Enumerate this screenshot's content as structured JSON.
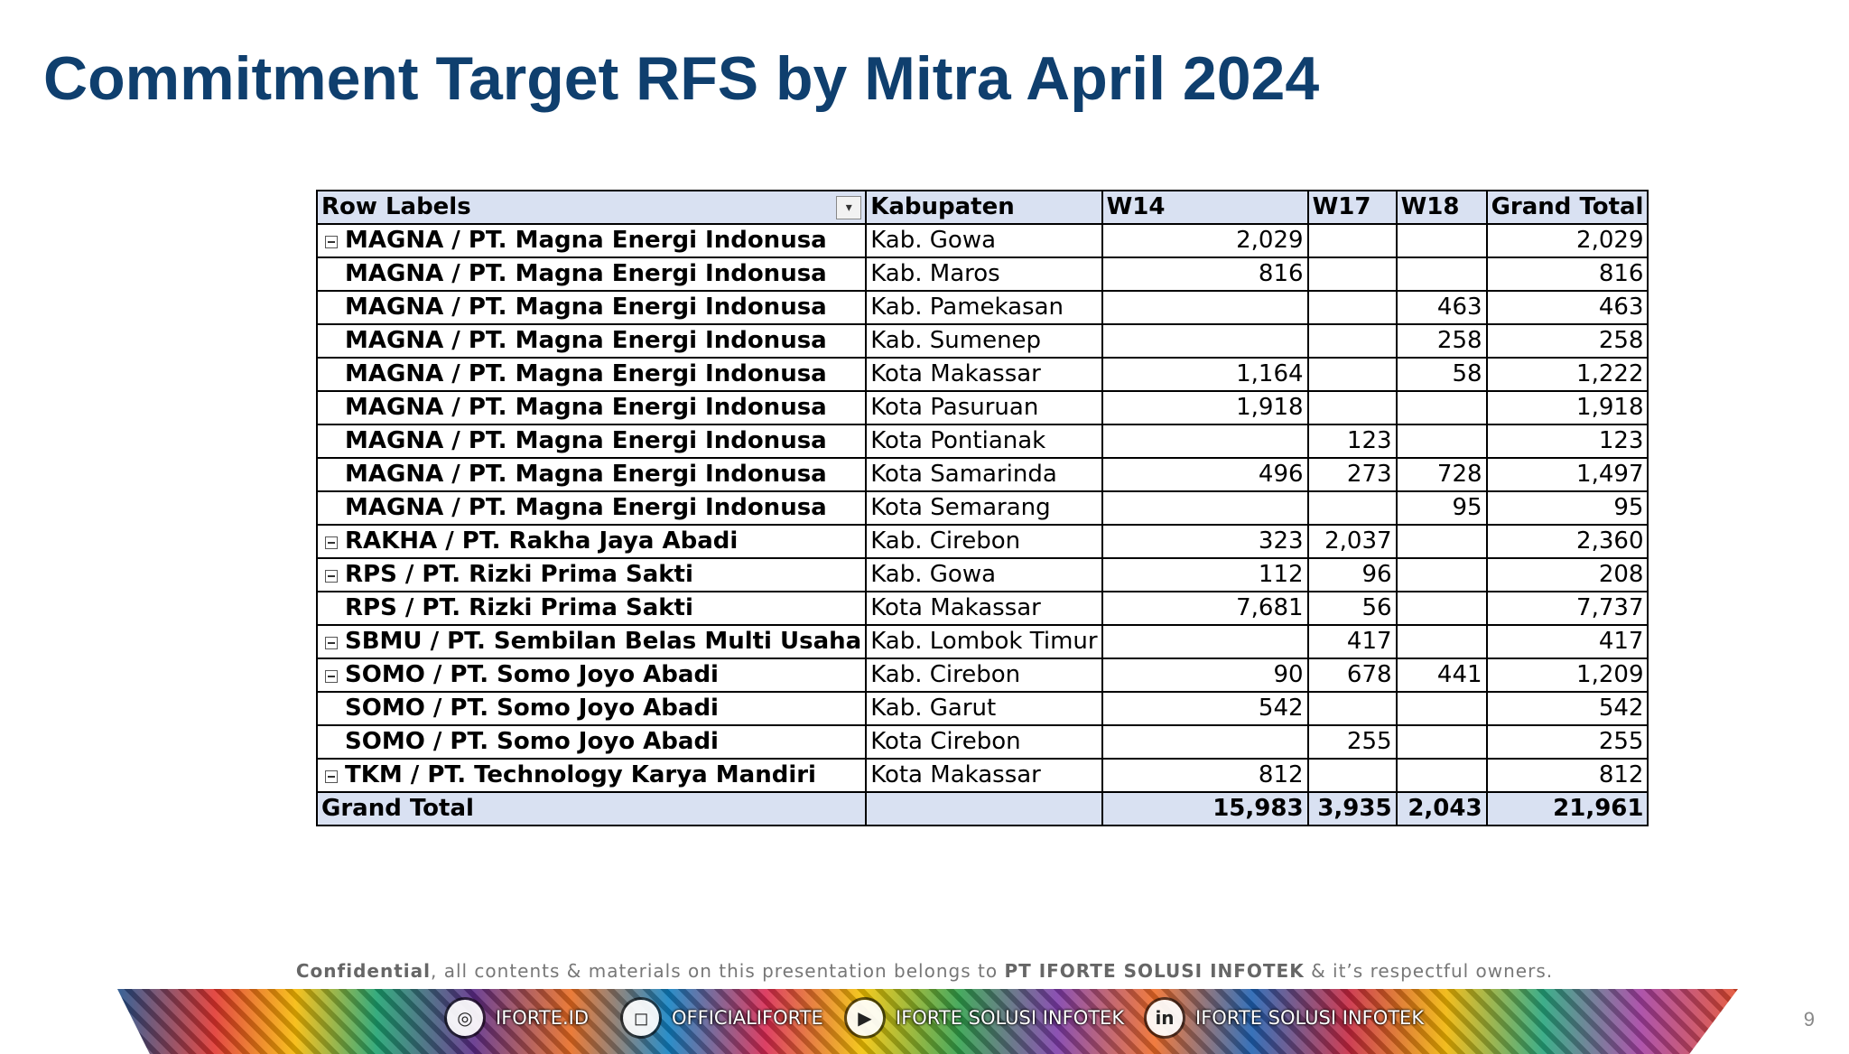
{
  "title": "Commitment Target RFS by Mitra April 2024",
  "table": {
    "headers": [
      "Row Labels",
      "Kabupaten",
      "W14",
      "W17",
      "W18",
      "Grand Total"
    ],
    "rows": [
      {
        "label": "MAGNA / PT. Magna Energi Indonusa",
        "kab": "Kab. Gowa",
        "w14": "2,029",
        "w17": "",
        "w18": "",
        "total": "2,029"
      },
      {
        "label": "MAGNA / PT. Magna Energi Indonusa",
        "kab": "Kab. Maros",
        "w14": "816",
        "w17": "",
        "w18": "",
        "total": "816"
      },
      {
        "label": "MAGNA / PT. Magna Energi Indonusa",
        "kab": "Kab. Pamekasan",
        "w14": "",
        "w17": "",
        "w18": "463",
        "total": "463"
      },
      {
        "label": "MAGNA / PT. Magna Energi Indonusa",
        "kab": "Kab. Sumenep",
        "w14": "",
        "w17": "",
        "w18": "258",
        "total": "258"
      },
      {
        "label": "MAGNA / PT. Magna Energi Indonusa",
        "kab": "Kota Makassar",
        "w14": "1,164",
        "w17": "",
        "w18": "58",
        "total": "1,222"
      },
      {
        "label": "MAGNA / PT. Magna Energi Indonusa",
        "kab": "Kota Pasuruan",
        "w14": "1,918",
        "w17": "",
        "w18": "",
        "total": "1,918"
      },
      {
        "label": "MAGNA / PT. Magna Energi Indonusa",
        "kab": "Kota Pontianak",
        "w14": "",
        "w17": "123",
        "w18": "",
        "total": "123"
      },
      {
        "label": "MAGNA / PT. Magna Energi Indonusa",
        "kab": "Kota Samarinda",
        "w14": "496",
        "w17": "273",
        "w18": "728",
        "total": "1,497"
      },
      {
        "label": "MAGNA / PT. Magna Energi Indonusa",
        "kab": "Kota Semarang",
        "w14": "",
        "w17": "",
        "w18": "95",
        "total": "95"
      },
      {
        "label": "RAKHA / PT. Rakha Jaya Abadi",
        "kab": "Kab. Cirebon",
        "w14": "323",
        "w17": "2,037",
        "w18": "",
        "total": "2,360"
      },
      {
        "label": "RPS / PT. Rizki Prima Sakti",
        "kab": "Kab. Gowa",
        "w14": "112",
        "w17": "96",
        "w18": "",
        "total": "208"
      },
      {
        "label": "RPS / PT. Rizki Prima Sakti",
        "kab": "Kota Makassar",
        "w14": "7,681",
        "w17": "56",
        "w18": "",
        "total": "7,737"
      },
      {
        "label": "SBMU / PT. Sembilan Belas Multi Usaha",
        "kab": "Kab. Lombok Timur",
        "w14": "",
        "w17": "417",
        "w18": "",
        "total": "417"
      },
      {
        "label": "SOMO / PT. Somo Joyo Abadi",
        "kab": "Kab. Cirebon",
        "w14": "90",
        "w17": "678",
        "w18": "441",
        "total": "1,209"
      },
      {
        "label": "SOMO / PT. Somo Joyo Abadi",
        "kab": "Kab. Garut",
        "w14": "542",
        "w17": "",
        "w18": "",
        "total": "542"
      },
      {
        "label": "SOMO / PT. Somo Joyo Abadi",
        "kab": "Kota Cirebon",
        "w14": "",
        "w17": "255",
        "w18": "",
        "total": "255"
      },
      {
        "label": "TKM / PT. Technology Karya Mandiri",
        "kab": "Kota Makassar",
        "w14": "812",
        "w17": "",
        "w18": "",
        "total": "812"
      }
    ],
    "group_start_rows": [
      0,
      9,
      10,
      12,
      13,
      16
    ],
    "grand_total": {
      "label": "Grand Total",
      "kab": "",
      "w14": "15,983",
      "w17": "3,935",
      "w18": "2,043",
      "total": "21,961"
    }
  },
  "footer": {
    "confidential_bold": "Confidential",
    "confidential_pre": ", all contents & materials on this presentation belongs to ",
    "confidential_company": "PT IFORTE SOLUSI INFOTEK",
    "confidential_post": " & it’s respectful owners.",
    "socials": [
      {
        "icon": "globe-icon",
        "glyph": "◎",
        "text": "IFORTE.ID"
      },
      {
        "icon": "instagram-icon",
        "glyph": "◻",
        "text": "OFFICIALIFORTE"
      },
      {
        "icon": "youtube-icon",
        "glyph": "▶",
        "text": "IFORTE SOLUSI INFOTEK"
      },
      {
        "icon": "linkedin-icon",
        "glyph": "in",
        "text": "IFORTE SOLUSI INFOTEK"
      }
    ],
    "page_number": "9"
  },
  "colors": {
    "title": "#0f3f6e",
    "header_fill": "#d9e1f2"
  }
}
